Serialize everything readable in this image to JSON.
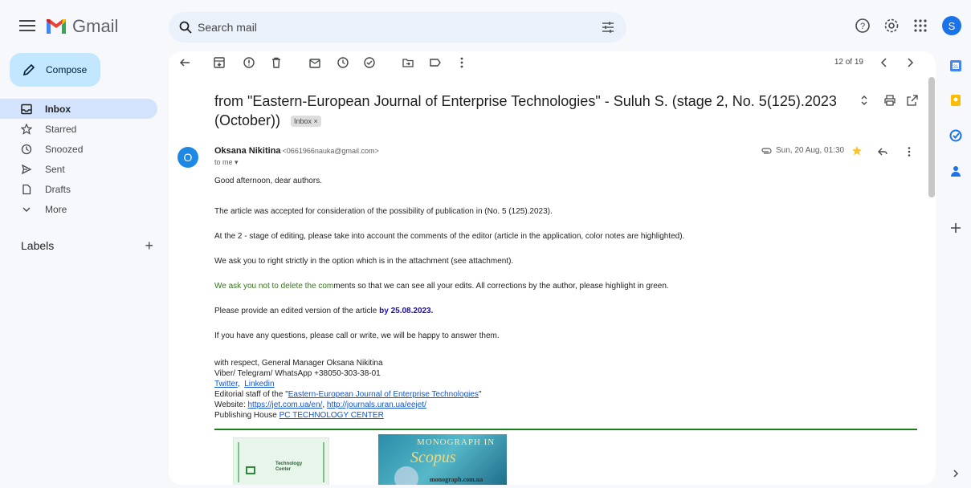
{
  "app": {
    "name": "Gmail"
  },
  "search": {
    "placeholder": "Search mail"
  },
  "user": {
    "avatar_letter": "S"
  },
  "compose": {
    "label": "Compose"
  },
  "nav": {
    "items": [
      {
        "label": "Inbox",
        "icon": "inbox-icon",
        "active": true
      },
      {
        "label": "Starred",
        "icon": "star-icon"
      },
      {
        "label": "Snoozed",
        "icon": "clock-icon"
      },
      {
        "label": "Sent",
        "icon": "send-icon"
      },
      {
        "label": "Drafts",
        "icon": "draft-icon"
      },
      {
        "label": "More",
        "icon": "chevron-down-icon"
      }
    ],
    "labels_heading": "Labels"
  },
  "toolbar": {
    "pager": "12 of 19"
  },
  "message": {
    "subject": "from \"Eastern-European Journal of Enterprise Technologies\" - Suluh S. (stage 2, No. 5(125).2023 (October))",
    "label_chip": "Inbox ×",
    "sender_initial": "O",
    "sender_name": "Oksana Nikitina",
    "sender_email": "<0661966nauka@gmail.com>",
    "to": "to me ▾",
    "date": "Sun, 20 Aug, 01:30",
    "body": {
      "greeting": "Good afternoon, dear authors.",
      "p1": "The article was accepted for consideration of the possibility of publication in (No. 5 (125).2023).",
      "p2": "At the 2 - stage of editing, please take into account the comments of the editor (article in the application, color notes are highlighted).",
      "p3": "We ask you to right strictly in the option which is in the attachment (see attachment).",
      "p4_green": "We ask you not to delete the com",
      "p4_rest": "ments so that we can see all your edits. All corrections by the author, please highlight in green.",
      "p5": "Please provide an edited version of the article ",
      "p5_deadline": "by 25.08.2023.",
      "p6": "If you have any questions, please call or write, we will be happy to answer them.",
      "sig_line1": "with respect, General Manager Oksana Nikitina",
      "sig_line2": "Viber/ Telegram/ WhatsApp  +38050-303-38-01",
      "sig_twitter": "Twitter",
      "sig_linkedin": "Linkedin",
      "sig_editorial_prefix": "Editorial staff of the \"",
      "sig_editorial_link": "Eastern-European  Journal of Enterprise Technologies",
      "sig_editorial_suffix": "\"",
      "sig_website_prefix": "Website: ",
      "sig_website_1": "https://jet.com.ua/en/",
      "sig_website_2": "http://journals.uran.ua/eejet/",
      "sig_publisher_prefix": "Publishing House ",
      "sig_publisher_link": "PC TECHNOLOGY CENTER"
    },
    "image1": {
      "text_line1": "Technology",
      "text_line2": "Center"
    },
    "image2": {
      "line1": "MONOGRAPH IN",
      "line2": "Scopus",
      "line3": "monograph.com.ua"
    }
  }
}
